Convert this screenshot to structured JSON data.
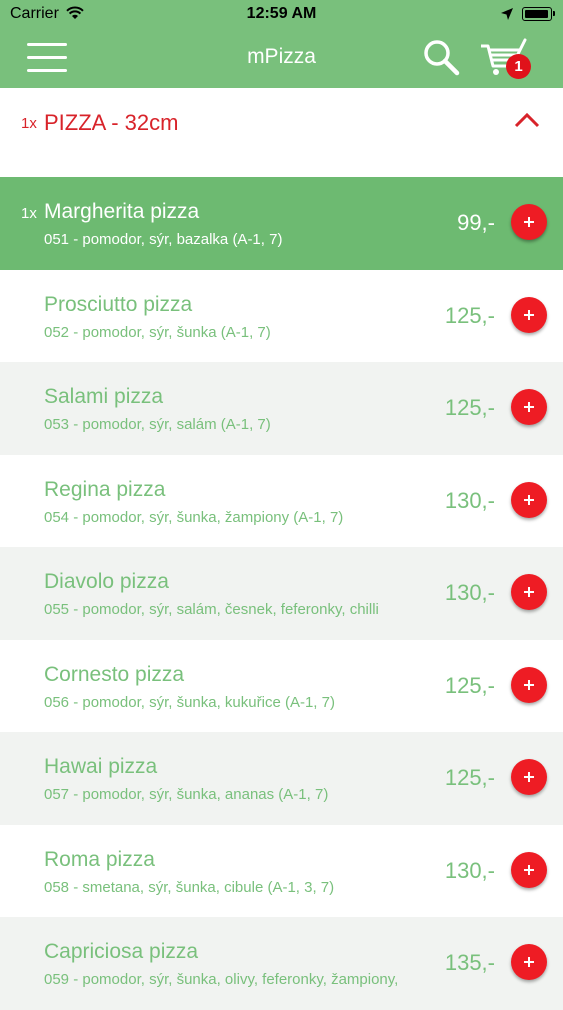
{
  "status_bar": {
    "carrier": "Carrier",
    "time": "12:59 AM",
    "battery_level": 1.0
  },
  "header": {
    "title": "mPizza",
    "cart_count": "1",
    "icons": [
      "menu-icon",
      "search-icon",
      "cart-icon"
    ]
  },
  "category": {
    "qty": "1x",
    "name": "PIZZA - 32cm",
    "expanded": true
  },
  "items": [
    {
      "qty": "1x",
      "name": "Margherita pizza",
      "desc": "051 - pomodor, sýr, bazalka (A-1, 7)",
      "price": "99,-",
      "selected": true
    },
    {
      "qty": "",
      "name": "Prosciutto pizza",
      "desc": "052 - pomodor, sýr, šunka (A-1, 7)",
      "price": "125,-",
      "selected": false
    },
    {
      "qty": "",
      "name": "Salami pizza",
      "desc": "053 - pomodor, sýr, salám (A-1, 7)",
      "price": "125,-",
      "selected": false
    },
    {
      "qty": "",
      "name": "Regina pizza",
      "desc": "054 - pomodor, sýr, šunka, žampiony (A-1, 7)",
      "price": "130,-",
      "selected": false
    },
    {
      "qty": "",
      "name": "Diavolo pizza",
      "desc": "055 - pomodor, sýr, salám, česnek, feferonky, chilli",
      "price": "130,-",
      "selected": false
    },
    {
      "qty": "",
      "name": "Cornesto pizza",
      "desc": "056 - pomodor, sýr, šunka, kukuřice (A-1, 7)",
      "price": "125,-",
      "selected": false
    },
    {
      "qty": "",
      "name": "Hawai pizza",
      "desc": "057 - pomodor, sýr, šunka, ananas (A-1, 7)",
      "price": "125,-",
      "selected": false
    },
    {
      "qty": "",
      "name": "Roma pizza",
      "desc": "058 - smetana, sýr, šunka, cibule (A-1, 3, 7)",
      "price": "130,-",
      "selected": false
    },
    {
      "qty": "",
      "name": "Capriciosa pizza",
      "desc": "059 - pomodor, sýr, šunka, olivy, feferonky, žampiony,",
      "price": "135,-",
      "selected": false
    }
  ],
  "colors": {
    "header_bg": "#79c07c",
    "accent_red": "#ee1c24",
    "text_green": "#79c07c",
    "selected_bg": "#6dba71",
    "alt_row_bg": "#f1f3f1"
  }
}
